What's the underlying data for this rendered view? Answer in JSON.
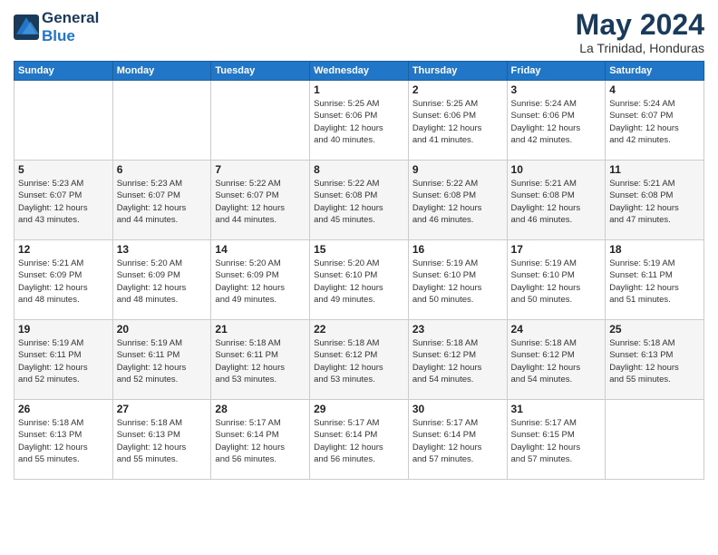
{
  "header": {
    "logo_line1": "General",
    "logo_line2": "Blue",
    "month_title": "May 2024",
    "subtitle": "La Trinidad, Honduras"
  },
  "weekdays": [
    "Sunday",
    "Monday",
    "Tuesday",
    "Wednesday",
    "Thursday",
    "Friday",
    "Saturday"
  ],
  "weeks": [
    [
      {
        "day": "",
        "info": ""
      },
      {
        "day": "",
        "info": ""
      },
      {
        "day": "",
        "info": ""
      },
      {
        "day": "1",
        "info": "Sunrise: 5:25 AM\nSunset: 6:06 PM\nDaylight: 12 hours\nand 40 minutes."
      },
      {
        "day": "2",
        "info": "Sunrise: 5:25 AM\nSunset: 6:06 PM\nDaylight: 12 hours\nand 41 minutes."
      },
      {
        "day": "3",
        "info": "Sunrise: 5:24 AM\nSunset: 6:06 PM\nDaylight: 12 hours\nand 42 minutes."
      },
      {
        "day": "4",
        "info": "Sunrise: 5:24 AM\nSunset: 6:07 PM\nDaylight: 12 hours\nand 42 minutes."
      }
    ],
    [
      {
        "day": "5",
        "info": "Sunrise: 5:23 AM\nSunset: 6:07 PM\nDaylight: 12 hours\nand 43 minutes."
      },
      {
        "day": "6",
        "info": "Sunrise: 5:23 AM\nSunset: 6:07 PM\nDaylight: 12 hours\nand 44 minutes."
      },
      {
        "day": "7",
        "info": "Sunrise: 5:22 AM\nSunset: 6:07 PM\nDaylight: 12 hours\nand 44 minutes."
      },
      {
        "day": "8",
        "info": "Sunrise: 5:22 AM\nSunset: 6:08 PM\nDaylight: 12 hours\nand 45 minutes."
      },
      {
        "day": "9",
        "info": "Sunrise: 5:22 AM\nSunset: 6:08 PM\nDaylight: 12 hours\nand 46 minutes."
      },
      {
        "day": "10",
        "info": "Sunrise: 5:21 AM\nSunset: 6:08 PM\nDaylight: 12 hours\nand 46 minutes."
      },
      {
        "day": "11",
        "info": "Sunrise: 5:21 AM\nSunset: 6:08 PM\nDaylight: 12 hours\nand 47 minutes."
      }
    ],
    [
      {
        "day": "12",
        "info": "Sunrise: 5:21 AM\nSunset: 6:09 PM\nDaylight: 12 hours\nand 48 minutes."
      },
      {
        "day": "13",
        "info": "Sunrise: 5:20 AM\nSunset: 6:09 PM\nDaylight: 12 hours\nand 48 minutes."
      },
      {
        "day": "14",
        "info": "Sunrise: 5:20 AM\nSunset: 6:09 PM\nDaylight: 12 hours\nand 49 minutes."
      },
      {
        "day": "15",
        "info": "Sunrise: 5:20 AM\nSunset: 6:10 PM\nDaylight: 12 hours\nand 49 minutes."
      },
      {
        "day": "16",
        "info": "Sunrise: 5:19 AM\nSunset: 6:10 PM\nDaylight: 12 hours\nand 50 minutes."
      },
      {
        "day": "17",
        "info": "Sunrise: 5:19 AM\nSunset: 6:10 PM\nDaylight: 12 hours\nand 50 minutes."
      },
      {
        "day": "18",
        "info": "Sunrise: 5:19 AM\nSunset: 6:11 PM\nDaylight: 12 hours\nand 51 minutes."
      }
    ],
    [
      {
        "day": "19",
        "info": "Sunrise: 5:19 AM\nSunset: 6:11 PM\nDaylight: 12 hours\nand 52 minutes."
      },
      {
        "day": "20",
        "info": "Sunrise: 5:19 AM\nSunset: 6:11 PM\nDaylight: 12 hours\nand 52 minutes."
      },
      {
        "day": "21",
        "info": "Sunrise: 5:18 AM\nSunset: 6:11 PM\nDaylight: 12 hours\nand 53 minutes."
      },
      {
        "day": "22",
        "info": "Sunrise: 5:18 AM\nSunset: 6:12 PM\nDaylight: 12 hours\nand 53 minutes."
      },
      {
        "day": "23",
        "info": "Sunrise: 5:18 AM\nSunset: 6:12 PM\nDaylight: 12 hours\nand 54 minutes."
      },
      {
        "day": "24",
        "info": "Sunrise: 5:18 AM\nSunset: 6:12 PM\nDaylight: 12 hours\nand 54 minutes."
      },
      {
        "day": "25",
        "info": "Sunrise: 5:18 AM\nSunset: 6:13 PM\nDaylight: 12 hours\nand 55 minutes."
      }
    ],
    [
      {
        "day": "26",
        "info": "Sunrise: 5:18 AM\nSunset: 6:13 PM\nDaylight: 12 hours\nand 55 minutes."
      },
      {
        "day": "27",
        "info": "Sunrise: 5:18 AM\nSunset: 6:13 PM\nDaylight: 12 hours\nand 55 minutes."
      },
      {
        "day": "28",
        "info": "Sunrise: 5:17 AM\nSunset: 6:14 PM\nDaylight: 12 hours\nand 56 minutes."
      },
      {
        "day": "29",
        "info": "Sunrise: 5:17 AM\nSunset: 6:14 PM\nDaylight: 12 hours\nand 56 minutes."
      },
      {
        "day": "30",
        "info": "Sunrise: 5:17 AM\nSunset: 6:14 PM\nDaylight: 12 hours\nand 57 minutes."
      },
      {
        "day": "31",
        "info": "Sunrise: 5:17 AM\nSunset: 6:15 PM\nDaylight: 12 hours\nand 57 minutes."
      },
      {
        "day": "",
        "info": ""
      }
    ]
  ]
}
